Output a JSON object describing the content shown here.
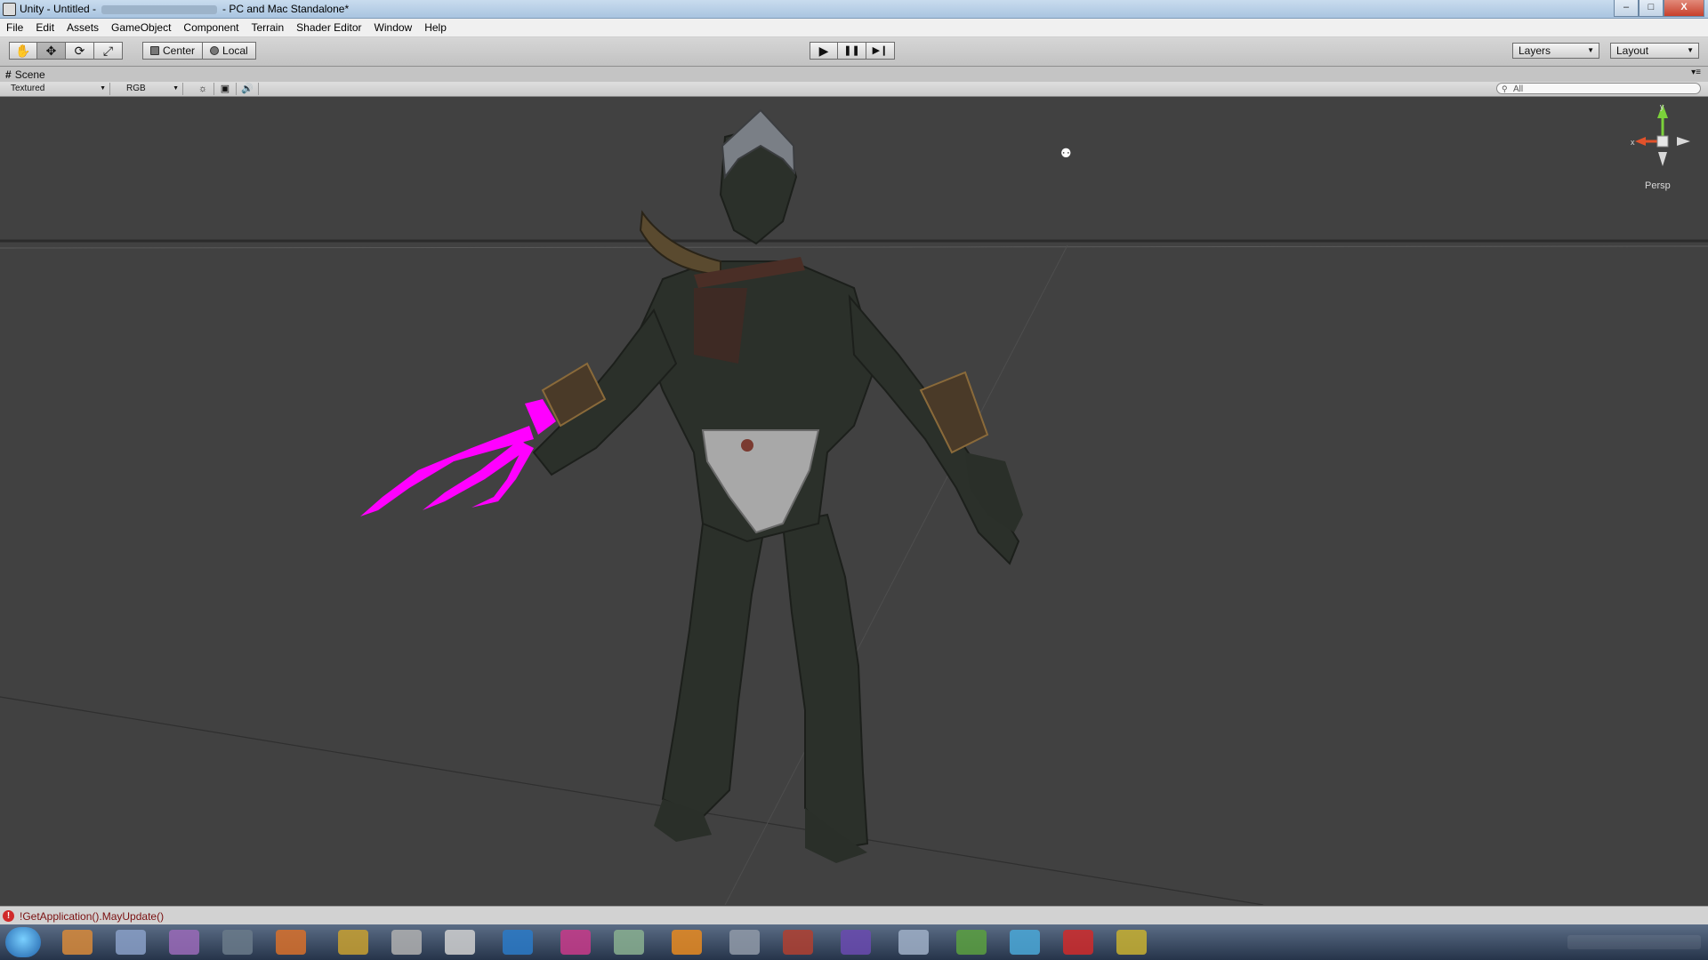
{
  "window": {
    "title_prefix": "Unity - Untitled -",
    "title_suffix": "- PC and Mac Standalone*",
    "minimize": "–",
    "maximize": "□",
    "close": "X"
  },
  "menubar": {
    "items": [
      "File",
      "Edit",
      "Assets",
      "GameObject",
      "Component",
      "Terrain",
      "Shader Editor",
      "Window",
      "Help"
    ]
  },
  "toolbar": {
    "tools": [
      {
        "name": "hand-tool",
        "icon": "hand-icon",
        "glyph": "✋"
      },
      {
        "name": "move-tool",
        "icon": "move-icon",
        "glyph": "✥"
      },
      {
        "name": "rotate-tool",
        "icon": "rotate-icon",
        "glyph": "⟳"
      },
      {
        "name": "scale-tool",
        "icon": "scale-icon",
        "glyph": "⤢"
      }
    ],
    "pivot_center": "Center",
    "pivot_local": "Local",
    "play_icon": "▶",
    "pause_icon": "❚❚",
    "step_icon": "▶❙",
    "layers": "Layers",
    "layout": "Layout",
    "dropdown_arrow": "▼"
  },
  "scene": {
    "tab_label": "Scene",
    "tab_hash": "#",
    "tab_menu": "▾≡",
    "render_mode": "Textured",
    "color_mode": "RGB",
    "lighting_icon": "☼",
    "image_icon": "▣",
    "audio_icon": "🔊",
    "search_placeholder": "All",
    "search_icon": "⚲",
    "gizmo_label": "Persp",
    "gizmo_y": "y",
    "gizmo_x": "x",
    "camera_glyph": "⚉",
    "colors": {
      "viewport": "#414141",
      "highlight": "#ff00ff",
      "gizmo_y": "#7bd13a",
      "gizmo_x": "#e2522b"
    }
  },
  "status": {
    "error_icon": "!",
    "message": "!GetApplication().MayUpdate()"
  }
}
